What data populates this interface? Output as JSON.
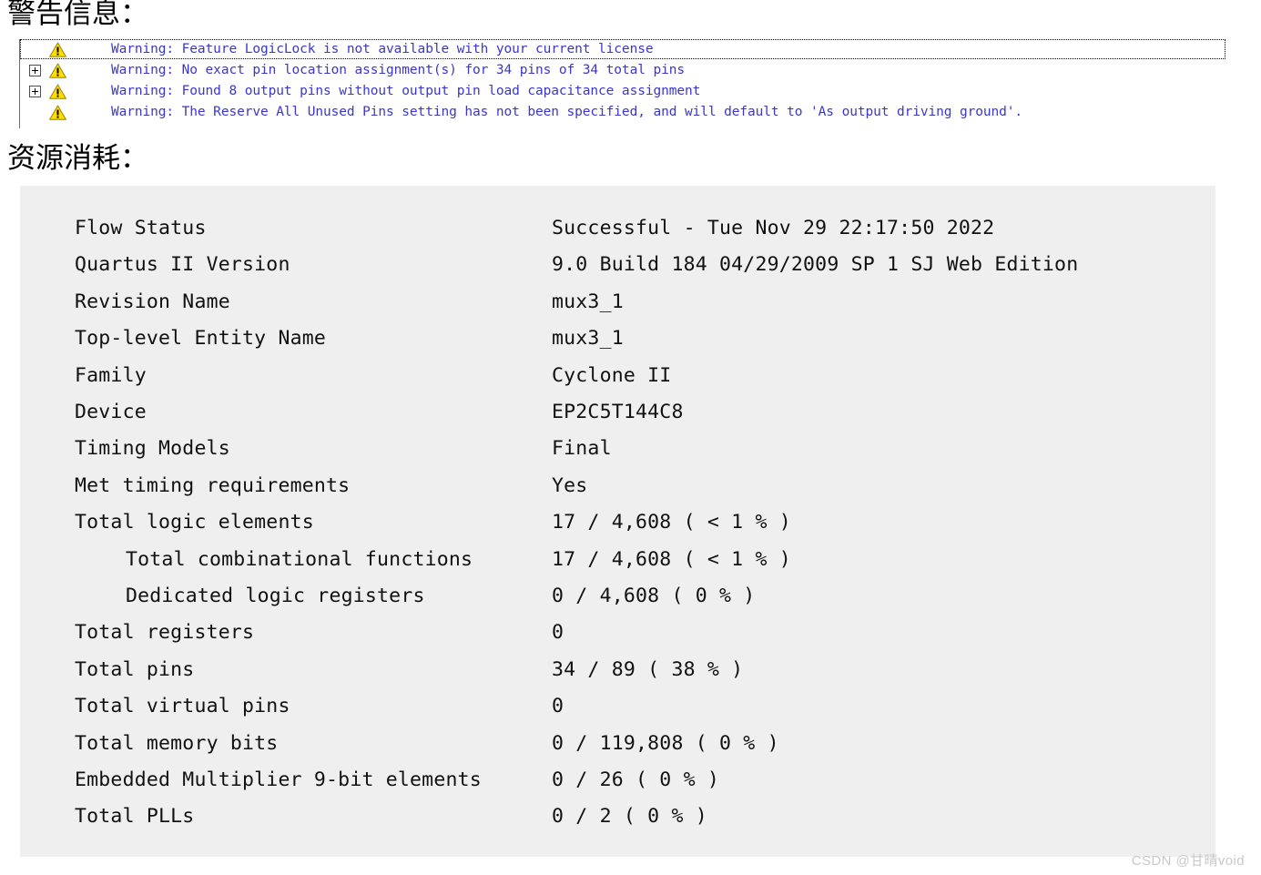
{
  "headings": {
    "warnings": "警告信息：",
    "resources": "资源消耗："
  },
  "colors": {
    "warning_text": "#3a36cf",
    "panel_background": "#efefef",
    "warning_icon_fill": "#ffdd00",
    "watermark": "#c9c9c9"
  },
  "warnings": {
    "rows": [
      {
        "icon": "warning-triangle-icon",
        "expandable": false,
        "selected": true,
        "text": "Warning: Feature LogicLock is not available with your current license"
      },
      {
        "icon": "warning-triangle-icon",
        "expandable": true,
        "selected": false,
        "expander": "plus-box-icon",
        "text": "Warning: No exact pin location assignment(s) for 34 pins of 34 total pins"
      },
      {
        "icon": "warning-triangle-icon",
        "expandable": true,
        "selected": false,
        "expander": "plus-box-icon",
        "text": "Warning: Found 8 output pins without output pin load capacitance assignment"
      },
      {
        "icon": "warning-triangle-icon",
        "expandable": false,
        "selected": false,
        "text": "Warning: The Reserve All Unused Pins setting has not been specified, and will default to 'As output driving ground'."
      }
    ]
  },
  "flow_summary": {
    "rows": [
      {
        "label": "Flow Status",
        "value": "Successful - Tue Nov 29 22:17:50 2022",
        "indent": false
      },
      {
        "label": "Quartus II Version",
        "value": "9.0 Build 184 04/29/2009 SP 1 SJ Web Edition",
        "indent": false
      },
      {
        "label": "Revision Name",
        "value": "mux3_1",
        "indent": false
      },
      {
        "label": "Top-level Entity Name",
        "value": "mux3_1",
        "indent": false
      },
      {
        "label": "Family",
        "value": "Cyclone II",
        "indent": false
      },
      {
        "label": "Device",
        "value": "EP2C5T144C8",
        "indent": false
      },
      {
        "label": "Timing Models",
        "value": "Final",
        "indent": false
      },
      {
        "label": "Met timing requirements",
        "value": "Yes",
        "indent": false
      },
      {
        "label": "Total logic elements",
        "value": "17 / 4,608 ( < 1 % )",
        "indent": false
      },
      {
        "label": "Total combinational functions",
        "value": "17 / 4,608 ( < 1 % )",
        "indent": true
      },
      {
        "label": "Dedicated logic registers",
        "value": "0 / 4,608 ( 0 % )",
        "indent": true
      },
      {
        "label": "Total registers",
        "value": "0",
        "indent": false
      },
      {
        "label": "Total pins",
        "value": "34 / 89 ( 38 % )",
        "indent": false
      },
      {
        "label": "Total virtual pins",
        "value": "0",
        "indent": false
      },
      {
        "label": "Total memory bits",
        "value": "0 / 119,808 ( 0 % )",
        "indent": false
      },
      {
        "label": "Embedded Multiplier 9-bit elements",
        "value": "0 / 26 ( 0 % )",
        "indent": false
      },
      {
        "label": "Total PLLs",
        "value": "0 / 2 ( 0 % )",
        "indent": false
      }
    ]
  },
  "watermark": "CSDN @甘晴void"
}
